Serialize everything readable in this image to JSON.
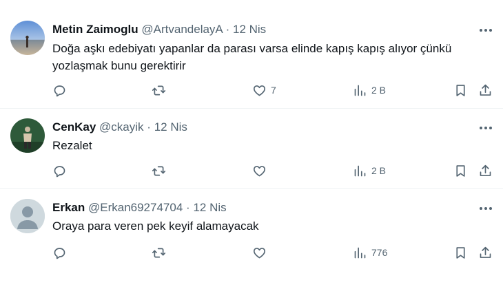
{
  "tweets": [
    {
      "name": "Metin Zaimoglu",
      "handle": "@ArtvandelayA",
      "separator": "·",
      "date": "12 Nis",
      "text": "Doğa aşkı edebiyatı yapanlar da parası varsa elinde kapış kapış alıyor çünkü yozlaşmak bunu gerektirir",
      "likes": "7",
      "views": "2 B"
    },
    {
      "name": "CenKay",
      "handle": "@ckayik",
      "separator": "·",
      "date": "12 Nis",
      "text": "Rezalet",
      "likes": "",
      "views": "2 B"
    },
    {
      "name": "Erkan",
      "handle": "@Erkan69274704",
      "separator": "·",
      "date": "12 Nis",
      "text": "Oraya para veren pek keyif alamayacak",
      "likes": "",
      "views": "776"
    }
  ],
  "icons": {
    "reply": "reply-icon",
    "retweet": "retweet-icon",
    "like": "heart-icon",
    "views": "views-chart-icon",
    "bookmark": "bookmark-icon",
    "share": "share-icon",
    "more": "more-horizontal-icon"
  },
  "colors": {
    "text": "#0f1419",
    "secondary": "#536471",
    "divider": "#eff3f4"
  }
}
